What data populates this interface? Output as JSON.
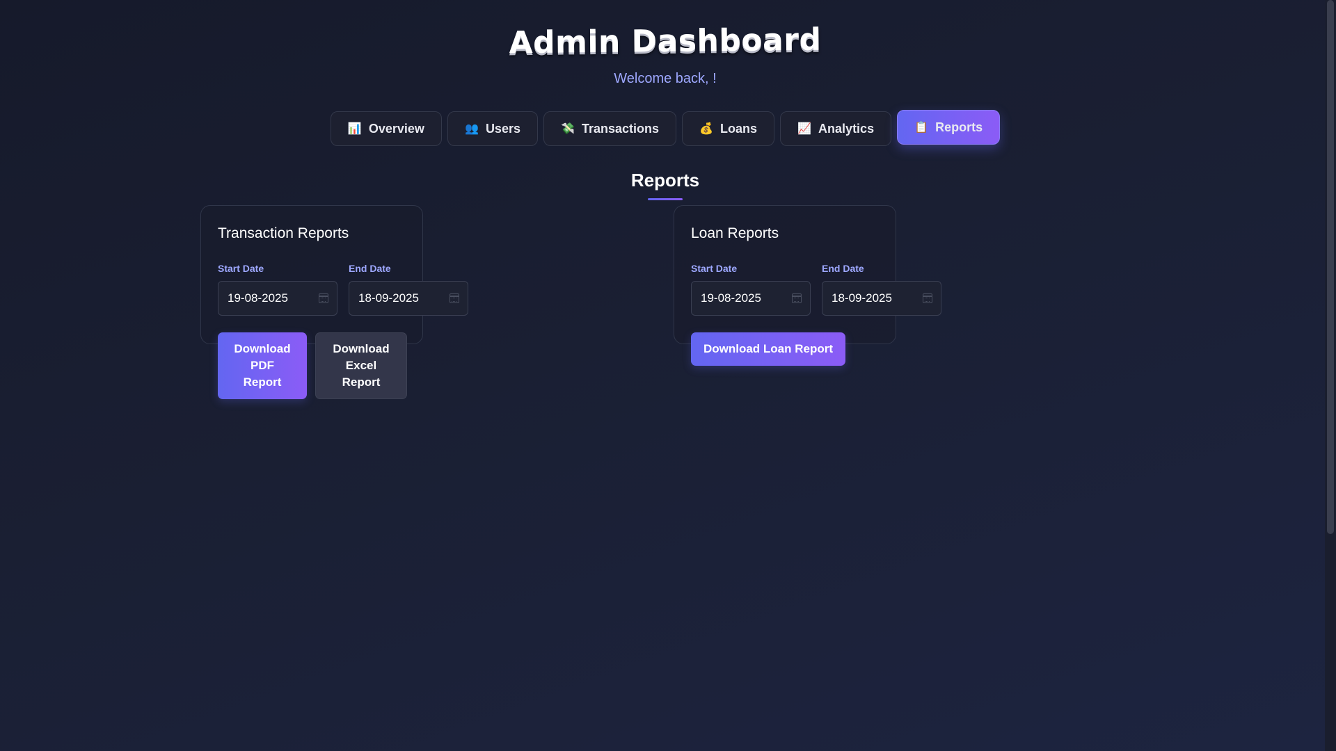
{
  "header": {
    "title": "Admin Dashboard",
    "welcome": "Welcome back, !"
  },
  "tabs": [
    {
      "label": "Overview",
      "icon": "📊",
      "active": false
    },
    {
      "label": "Users",
      "icon": "👥",
      "active": false
    },
    {
      "label": "Transactions",
      "icon": "💸",
      "active": false
    },
    {
      "label": "Loans",
      "icon": "💰",
      "active": false
    },
    {
      "label": "Analytics",
      "icon": "📈",
      "active": false
    },
    {
      "label": "Reports",
      "icon": "📋",
      "active": true
    }
  ],
  "section": {
    "title": "Reports"
  },
  "transaction_reports": {
    "title": "Transaction Reports",
    "start_label": "Start Date",
    "start_value": "19-08-2025",
    "end_label": "End Date",
    "end_value": "18-09-2025",
    "pdf_button": "Download PDF Report",
    "excel_button": "Download Excel Report"
  },
  "loan_reports": {
    "title": "Loan Reports",
    "start_label": "Start Date",
    "start_value": "19-08-2025",
    "end_label": "End Date",
    "end_value": "18-09-2025",
    "download_button": "Download Loan Report"
  },
  "colors": {
    "accent_start": "#6366f1",
    "accent_end": "#8b5cf6",
    "label": "#9ea8ff",
    "background": "#161a2b"
  }
}
